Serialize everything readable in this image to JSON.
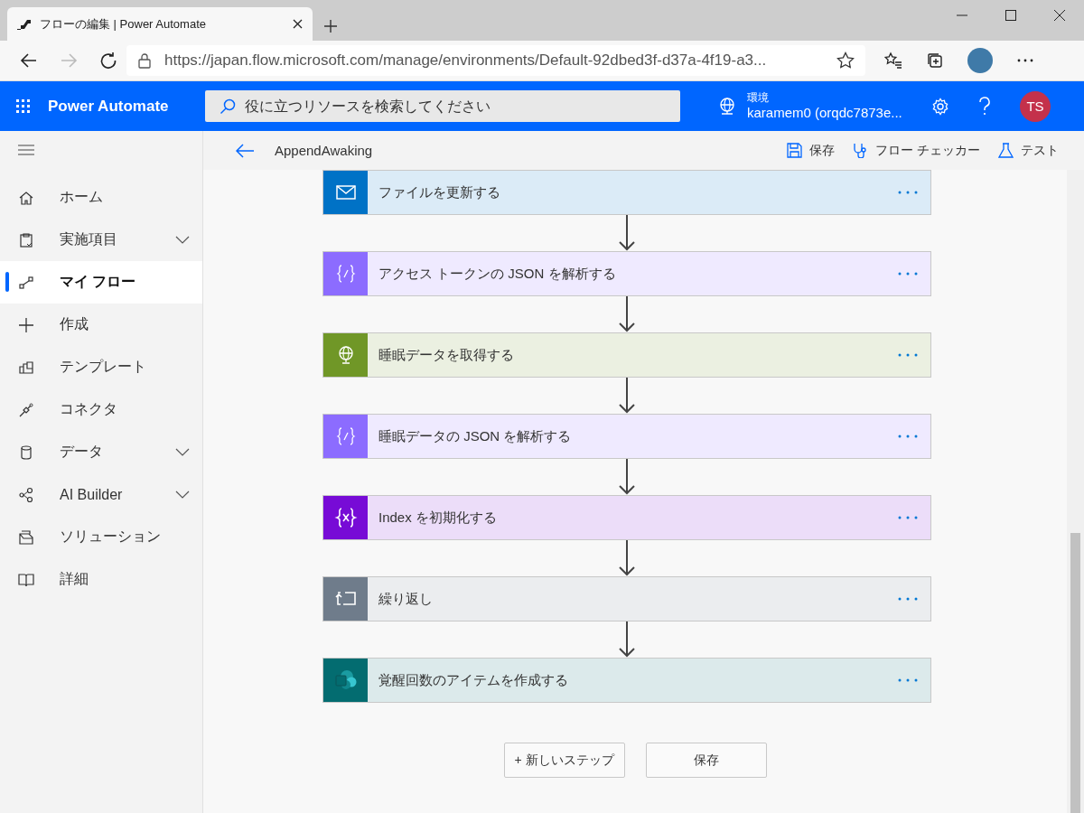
{
  "browser": {
    "tab_title": "フローの編集 | Power Automate",
    "url": "https://japan.flow.microsoft.com/manage/environments/Default-92dbed3f-d37a-4f19-a3..."
  },
  "header": {
    "app_name": "Power Automate",
    "search": {
      "placeholder": "役に立つリソースを検索してください"
    },
    "environment_label": "環境",
    "environment_name": "karamem0 (orqdc7873e...",
    "avatar": "TS"
  },
  "sidebar": {
    "items": [
      {
        "label": "ホーム",
        "expandable": false,
        "selected": false
      },
      {
        "label": "実施項目",
        "expandable": true,
        "selected": false
      },
      {
        "label": "マイ フロー",
        "expandable": false,
        "selected": true
      },
      {
        "label": "作成",
        "expandable": false,
        "selected": false
      },
      {
        "label": "テンプレート",
        "expandable": false,
        "selected": false
      },
      {
        "label": "コネクタ",
        "expandable": false,
        "selected": false
      },
      {
        "label": "データ",
        "expandable": true,
        "selected": false
      },
      {
        "label": "AI Builder",
        "expandable": true,
        "selected": false
      },
      {
        "label": "ソリューション",
        "expandable": false,
        "selected": false
      },
      {
        "label": "詳細",
        "expandable": false,
        "selected": false
      }
    ]
  },
  "command_bar": {
    "flow_name": "AppendAwaking",
    "actions": [
      {
        "label": "保存",
        "kind": "save"
      },
      {
        "label": "フロー チェッカー",
        "kind": "checker"
      },
      {
        "label": "テスト",
        "kind": "test"
      }
    ]
  },
  "steps": [
    {
      "title": "ファイルを更新する",
      "kind": "file",
      "color": "#0072c6"
    },
    {
      "title": "アクセス トークンの JSON を解析する",
      "kind": "json",
      "color": "#8c6cff"
    },
    {
      "title": "睡眠データを取得する",
      "kind": "http",
      "color": "#709727"
    },
    {
      "title": "睡眠データの JSON を解析する",
      "kind": "json",
      "color": "#8c6cff"
    },
    {
      "title": "Index を初期化する",
      "kind": "variable",
      "color": "#770bd6"
    },
    {
      "title": "繰り返し",
      "kind": "loop",
      "color": "#6f7c8b"
    },
    {
      "title": "覚醒回数のアイテムを作成する",
      "kind": "sharepoint",
      "color": "#036c70"
    }
  ],
  "buttons": [
    "+ 新しいステップ",
    "保存"
  ]
}
